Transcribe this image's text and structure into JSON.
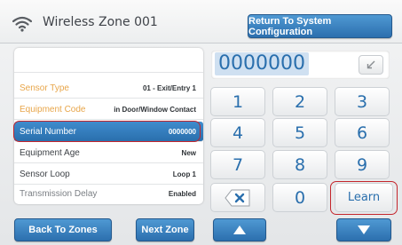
{
  "header": {
    "title": "Wireless Zone 001",
    "return_button": "Return To System Configuration",
    "wifi_icon": "wifi-icon"
  },
  "zone_fields": [
    {
      "label": "",
      "value": ""
    },
    {
      "label": "Sensor Type",
      "value": "01 - Exit/Entry 1"
    },
    {
      "label": "Equipment Code",
      "value": "in Door/Window Contact"
    },
    {
      "label": "Serial Number",
      "value": "0000000"
    },
    {
      "label": "Equipment Age",
      "value": "New"
    },
    {
      "label": "Sensor Loop",
      "value": "Loop 1"
    },
    {
      "label": "Transmission Delay",
      "value": "Enabled"
    }
  ],
  "keypad": {
    "display_value": "0000000",
    "keys": [
      "1",
      "2",
      "3",
      "4",
      "5",
      "6",
      "7",
      "8",
      "9",
      "0"
    ],
    "learn_label": "Learn",
    "clear_icon": "clear-x-icon",
    "backspace_icon": "backspace-arrow-icon"
  },
  "footer": {
    "back_button": "Back To Zones",
    "next_button": "Next Zone",
    "up_icon": "up-arrow-icon",
    "down_icon": "down-arrow-icon"
  },
  "colors": {
    "accent_blue": "#2c6fae",
    "highlight_red": "#c4252c",
    "muted_orange": "#e8a64a"
  }
}
